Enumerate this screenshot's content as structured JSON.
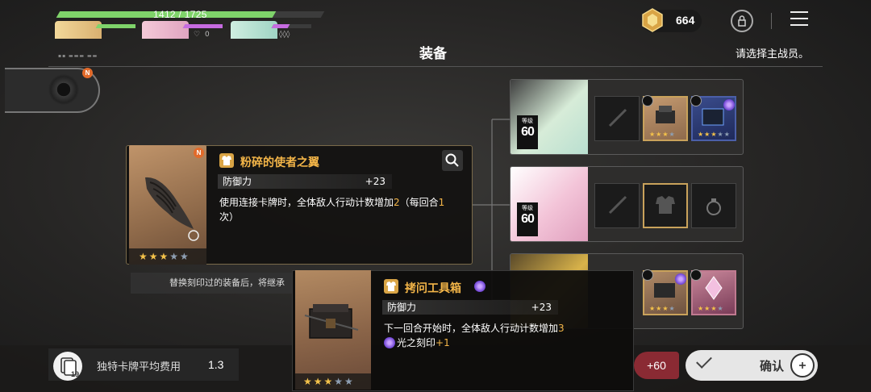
{
  "party": {
    "hp_text": "1412 / 1725",
    "hp_fraction": 0.818,
    "members": [
      {
        "name_icon": "portrait-blonde"
      },
      {
        "name_icon": "portrait-pink",
        "status": "0"
      },
      {
        "name_icon": "portrait-teal"
      }
    ]
  },
  "header": {
    "currency_value": "664",
    "title": "装备",
    "hint": "请选择主战员。"
  },
  "emblem_badge": "N",
  "detail": {
    "badge": "N",
    "name": "粉碎的使者之翼",
    "stat_label": "防御力",
    "stat_value": "+23",
    "desc_parts": [
      "使用连接卡牌时，全体敌人行动计数增加",
      "2",
      "（每回合",
      "1",
      "次）"
    ],
    "stars_on": "★★★",
    "stars_off": "★★"
  },
  "notice": "替换刻印过的装备后，将继承",
  "characters": [
    {
      "level_label": "等级",
      "level": "60"
    },
    {
      "level_label": "等级",
      "level": "60"
    },
    {
      "level_label": "",
      "level": ""
    }
  ],
  "card2": {
    "name": "拷问工具箱",
    "stat_label": "防御力",
    "stat_value": "+23",
    "desc_a": "下一回合开始时，全体敌人行动计数增加",
    "desc_a_num": "3",
    "desc_b": "光之刻印",
    "desc_b_num": "+1",
    "stars_on": "★★★",
    "stars_off": "★★"
  },
  "bottom": {
    "deck_count": "19",
    "deck_label": "独特卡牌平均费用",
    "deck_value": "1.3",
    "bonus": "+60",
    "confirm_label": "确认"
  },
  "colors": {
    "hp_green": "#7fd36a",
    "accent_gold": "#f3b548",
    "star_gold": "#f4c24a",
    "confirm_bg": "#e6e6e6",
    "bonus_red": "#8a2a33"
  },
  "icons": [
    "gem-icon",
    "lock-icon",
    "menu-icon",
    "search-icon",
    "armor-icon",
    "sword-icon",
    "ring-icon",
    "check-icon"
  ]
}
